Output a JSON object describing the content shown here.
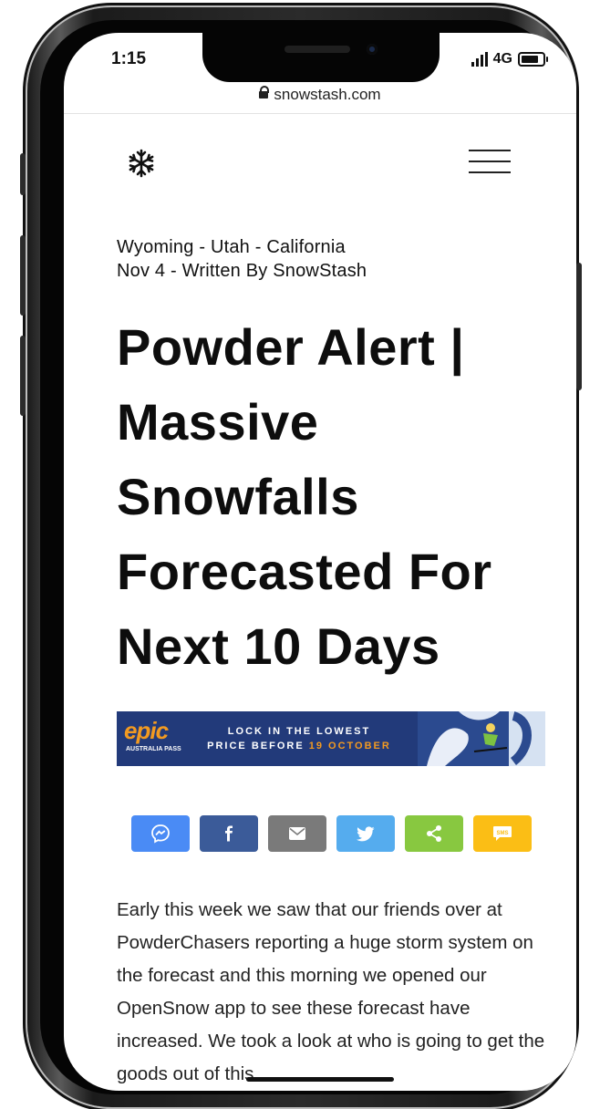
{
  "status_bar": {
    "time": "1:15",
    "network": "4G",
    "battery_level": 0.8
  },
  "browser": {
    "url": "snowstash.com"
  },
  "nav": {
    "logo_icon": "snowflake-icon",
    "menu_icon": "hamburger-menu-icon"
  },
  "article": {
    "locations": "Wyoming  -  Utah  -  California",
    "byline": "Nov 4   -  Written By SnowStash",
    "title": "Powder Alert | Massive Snowfalls Forecasted For Next 10 Days",
    "body": "Early this week we saw that our friends over at PowderChasers reporting a huge storm system on the forecast and this morning we opened our OpenSnow app to see these forecast have increased. We took a look at who is going to get the goods out of this"
  },
  "ad_banner": {
    "logo": "epic",
    "logo_sub": "AUSTRALIA PASS",
    "line1": "LOCK IN THE LOWEST",
    "line2_prefix": "PRICE BEFORE ",
    "line2_accent": "19 OCTOBER",
    "colors": {
      "background": "#223a7a",
      "accent": "#f29a21"
    }
  },
  "share_buttons": [
    {
      "id": "messenger",
      "icon": "messenger-icon",
      "color": "#4a8bf5"
    },
    {
      "id": "facebook",
      "icon": "facebook-icon",
      "color": "#3b5b99"
    },
    {
      "id": "email",
      "icon": "email-icon",
      "color": "#7a7a7a"
    },
    {
      "id": "twitter",
      "icon": "twitter-icon",
      "color": "#55acee"
    },
    {
      "id": "share",
      "icon": "share-icon",
      "color": "#88c840"
    },
    {
      "id": "sms",
      "icon": "sms-icon",
      "color": "#fbbe15",
      "label": "SMS"
    }
  ]
}
